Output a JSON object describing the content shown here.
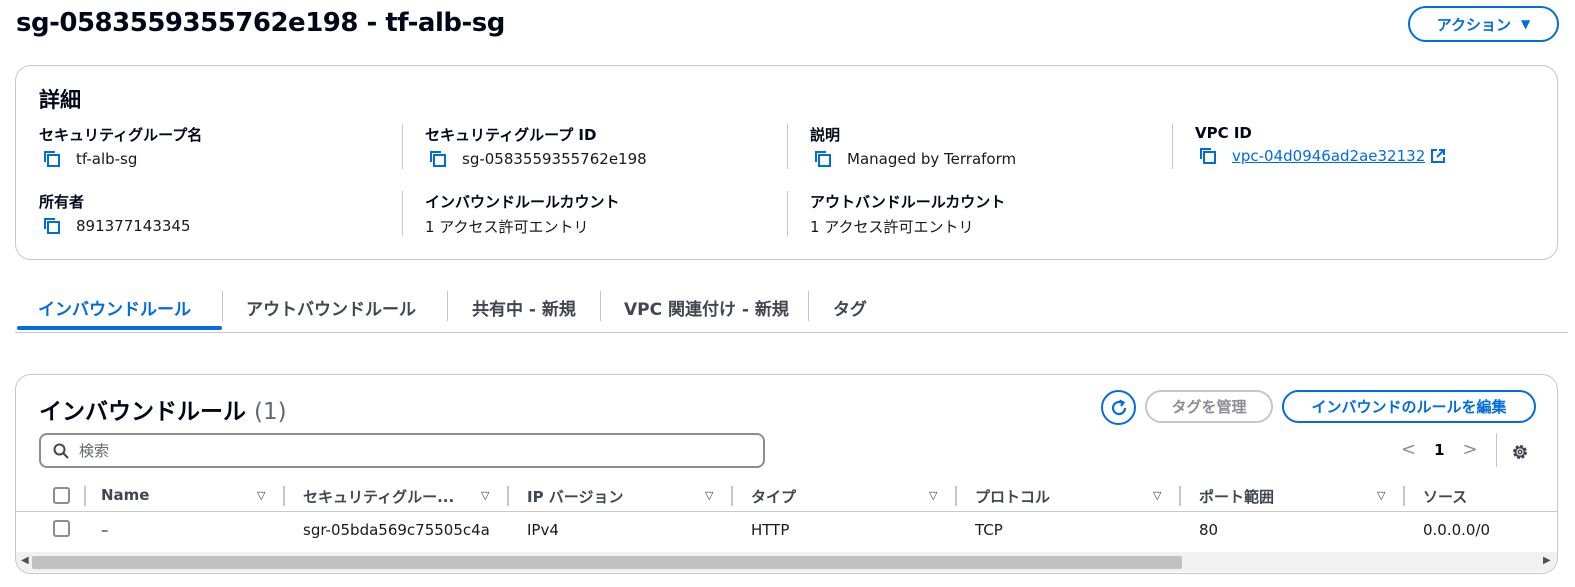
{
  "header": {
    "title": "sg-0583559355762e198 - tf-alb-sg",
    "actions_label": "アクション"
  },
  "details": {
    "title": "詳細",
    "sg_name_label": "セキュリティグループ名",
    "sg_name_value": "tf-alb-sg",
    "sg_id_label": "セキュリティグループ ID",
    "sg_id_value": "sg-0583559355762e198",
    "description_label": "説明",
    "description_value": "Managed by Terraform",
    "vpc_id_label": "VPC ID",
    "vpc_id_value": "vpc-04d0946ad2ae32132",
    "owner_label": "所有者",
    "owner_value": "891377143345",
    "inbound_count_label": "インバウンドルールカウント",
    "inbound_count_value": "1 アクセス許可エントリ",
    "outbound_count_label": "アウトバンドルールカウント",
    "outbound_count_value": "1 アクセス許可エントリ"
  },
  "tabs": [
    {
      "label": "インバウンドルール"
    },
    {
      "label": "アウトバウンドルール"
    },
    {
      "label": "共有中 - 新規"
    },
    {
      "label": "VPC 関連付け - 新規"
    },
    {
      "label": "タグ"
    }
  ],
  "rules": {
    "title": "インバウンドルール",
    "count": "(1)",
    "manage_tags_label": "タグを管理",
    "edit_rules_label": "インバウンドのルールを編集",
    "search_placeholder": "検索",
    "page": "1",
    "columns": [
      "Name",
      "セキュリティグルー...",
      "IP バージョン",
      "タイプ",
      "プロトコル",
      "ポート範囲",
      "ソース"
    ],
    "rows": [
      {
        "name": "–",
        "rule_id": "sgr-05bda569c75505c4a",
        "ip_version": "IPv4",
        "type": "HTTP",
        "protocol": "TCP",
        "port_range": "80",
        "source": "0.0.0.0/0"
      }
    ]
  },
  "colors": {
    "accent": "#006ce0",
    "border": "#c6c6cd",
    "text": "#16191f"
  }
}
